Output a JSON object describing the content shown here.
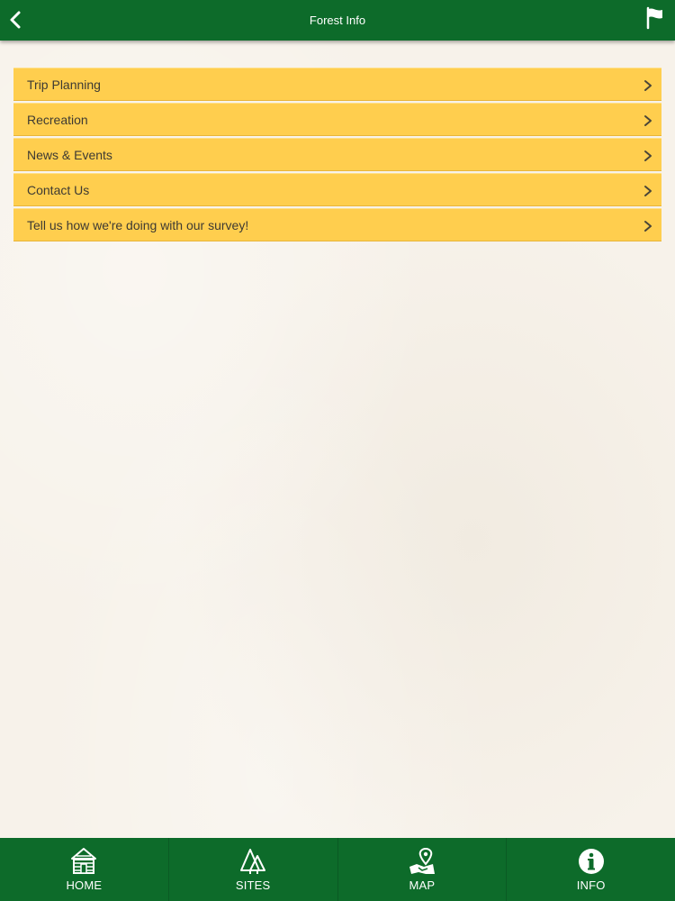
{
  "header": {
    "title": "Forest Info",
    "back_icon": "chevron-left-icon",
    "flag_icon": "flag-icon"
  },
  "menu": {
    "items": [
      {
        "label": "Trip Planning",
        "icon": "chevron-right-icon"
      },
      {
        "label": "Recreation",
        "icon": "chevron-right-icon"
      },
      {
        "label": "News & Events",
        "icon": "chevron-right-icon"
      },
      {
        "label": "Contact Us",
        "icon": "chevron-right-icon"
      },
      {
        "label": "Tell us how we're doing with our survey!",
        "icon": "chevron-right-icon"
      }
    ]
  },
  "tabbar": {
    "tabs": [
      {
        "label": "HOME",
        "icon": "cabin-icon"
      },
      {
        "label": "SITES",
        "icon": "trees-icon"
      },
      {
        "label": "MAP",
        "icon": "map-pin-icon"
      },
      {
        "label": "INFO",
        "icon": "info-icon"
      }
    ]
  },
  "colors": {
    "header_green": "#0d6b2a",
    "menu_yellow": "#ffce4e",
    "background": "#f7f2ea",
    "text_dark": "#3d3a33"
  }
}
